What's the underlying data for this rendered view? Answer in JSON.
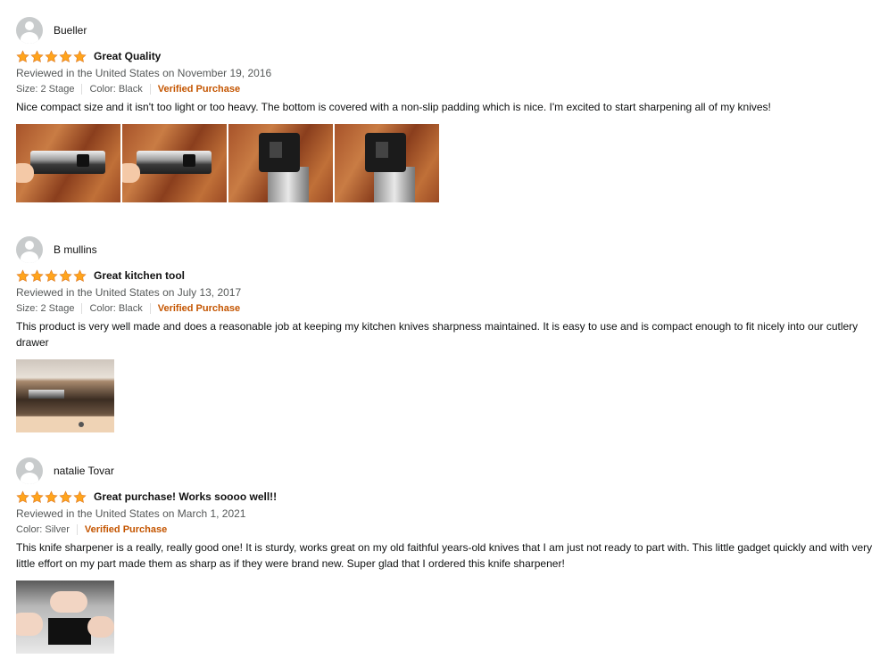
{
  "reviews": [
    {
      "name": "Bueller",
      "rating": 5,
      "title": "Great Quality",
      "date": "Reviewed in the United States on November 19, 2016",
      "size": "Size: 2 Stage",
      "color": "Color: Black",
      "verified": "Verified Purchase",
      "body": "Nice compact size and it isn't too light or too heavy. The bottom is covered with a non-slip padding which is nice. I'm excited to start sharpening all of my knives!"
    },
    {
      "name": "B mullins",
      "rating": 5,
      "title": "Great kitchen tool",
      "date": "Reviewed in the United States on July 13, 2017",
      "size": "Size: 2 Stage",
      "color": "Color: Black",
      "verified": "Verified Purchase",
      "body": "This product is very well made and does a reasonable job at keeping my kitchen knives sharpness maintained. It is easy to use and is compact enough to fit nicely into our cutlery drawer"
    },
    {
      "name": "natalie Tovar",
      "rating": 5,
      "title": "Great purchase! Works soooo well!!",
      "date": "Reviewed in the United States on March 1, 2021",
      "color": "Color: Silver",
      "verified": "Verified Purchase",
      "body": "This knife sharpener is a really, really good one! It is sturdy, works great on my old faithful years-old knives that I am just not ready to part with. This little gadget quickly and with very little effort on my part made them as sharp as if they were brand new. Super glad that I ordered this knife sharpener!"
    }
  ],
  "colors": {
    "star": "#ffa41c",
    "verified": "#c45500",
    "meta": "#565959"
  }
}
